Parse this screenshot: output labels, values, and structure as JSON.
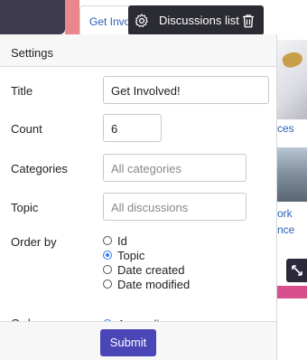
{
  "background": {
    "tab_label": "Get Invo",
    "card1_text": "ces",
    "card2_text_line1": "ork",
    "card2_text_line2": "nce",
    "corner_icon": "resize-arrows-icon",
    "colors": {
      "dark": "#3d3a4d",
      "pink": "#e8878c",
      "magenta": "#d84f8e",
      "link": "#2c5fb8"
    }
  },
  "toolbar": {
    "label": "Discussions list",
    "settings_icon": "gear-icon",
    "delete_icon": "trash-icon"
  },
  "panel": {
    "title": "Settings",
    "fields": {
      "title": {
        "label": "Title",
        "value": "Get Involved!"
      },
      "count": {
        "label": "Count",
        "value": "6"
      },
      "categories": {
        "label": "Categories",
        "placeholder": "All categories"
      },
      "topic": {
        "label": "Topic",
        "placeholder": "All discussions"
      }
    },
    "order_by": {
      "label": "Order by",
      "options": [
        "Id",
        "Topic",
        "Date created",
        "Date modified"
      ],
      "selected": "Topic"
    },
    "order": {
      "label": "Order",
      "selected": "Ascending"
    },
    "submit_label": "Submit",
    "accent_color": "#4a46b8"
  }
}
